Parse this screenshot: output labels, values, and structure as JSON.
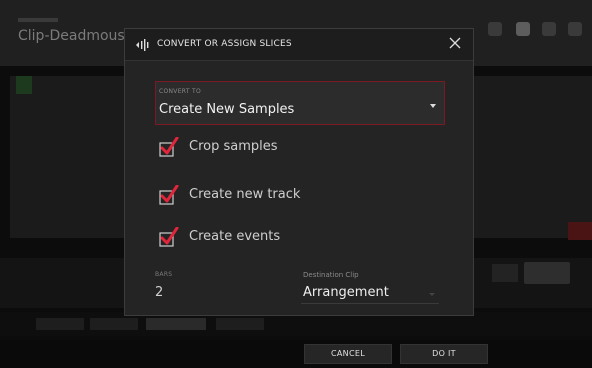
{
  "background": {
    "title": "Clip-Deadmouse-D"
  },
  "dialog": {
    "title": "CONVERT OR ASSIGN SLICES",
    "close_icon": "close-icon",
    "header_icon": "slices-icon",
    "convert_to": {
      "label": "CONVERT TO",
      "value": "Create New Samples"
    },
    "checkboxes": [
      {
        "label": "Crop samples",
        "checked": true
      },
      {
        "label": "Create new track",
        "checked": true
      },
      {
        "label": "Create events",
        "checked": true
      }
    ],
    "bars": {
      "label": "BARS",
      "value": "2"
    },
    "destination": {
      "label": "Destination Clip",
      "value": "Arrangement"
    }
  },
  "footer": {
    "cancel_label": "CANCEL",
    "confirm_label": "DO IT"
  },
  "colors": {
    "accent_red": "#e0263a",
    "dialog_bg": "#242424"
  }
}
